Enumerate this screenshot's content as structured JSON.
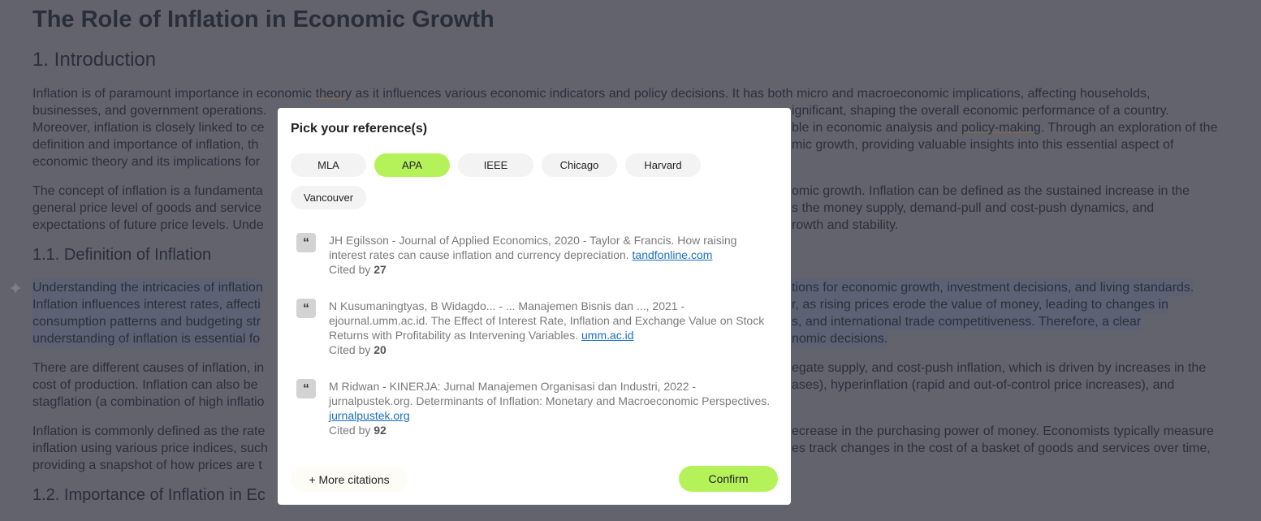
{
  "document": {
    "title": "The Role of Inflation in Economic Growth",
    "h_intro": "1. Introduction",
    "h_definition": "1.1. Definition of Inflation",
    "h_importance": "1.2. Importance of Inflation in Ec",
    "p1": [
      {
        "l": "Inflation is of paramount importance in economic ",
        "u": "theory",
        "l2": " as it influences various economic indicators and policy decisions. It has both micro and macroeconomic implications, affecting households,"
      },
      {
        "l": "businesses, and government operations.",
        "r": "ignificant, shaping the overall economic performance of a country."
      },
      {
        "l": "Moreover, inflation is closely linked to ce",
        "r": "ble in economic analysis and ",
        "ru": "policy-making",
        "r2": ". Through an exploration of the"
      },
      {
        "l": "definition and importance of inflation, th",
        "r": "mic growth, providing valuable insights into this essential aspect of"
      },
      {
        "l": "economic theory and its implications for",
        "r": ""
      }
    ],
    "p2": [
      {
        "l": "The concept of inflation is a fundamenta",
        "r": "omic growth. Inflation can be defined as the sustained increase in the"
      },
      {
        "l": "general price level of goods and service",
        "r": "s the money supply, demand-pull and cost-push dynamics, and"
      },
      {
        "l": "expectations of future price levels. Unde",
        "r": "rowth and stability."
      }
    ],
    "p3": [
      {
        "l": "Understanding the intricacies of inflation",
        "r": "tions for economic growth, investment decisions, and living standards."
      },
      {
        "l": "Inflation influences interest rates, affecti",
        "r": "r, as rising prices erode the value of money, leading to changes in"
      },
      {
        "l": "consumption patterns and budgeting str",
        "r": "s, and international trade competitiveness. Therefore, a clear"
      },
      {
        "l": "understanding of inflation is essential fo",
        "r": "nomic decisions."
      }
    ],
    "p4": [
      {
        "l": "There are different causes of inflation, in",
        "r": "egate supply, and cost-push inflation, which is driven by increases in the"
      },
      {
        "l": "cost of production. Inflation can also be",
        "r": "ases), hyperinflation (rapid and out-of-control price increases), and"
      },
      {
        "l": "stagflation (a combination of high inflatio",
        "r": ""
      }
    ],
    "p5": [
      {
        "l": "Inflation is commonly defined as the rate",
        "r": "ecrease in the purchasing power of money. Economists typically measure"
      },
      {
        "l": "inflation using various price indices, such",
        "r": "es track changes in the cost of a basket of goods and services over time,"
      },
      {
        "l": "providing a snapshot of how prices are t",
        "r": ""
      }
    ]
  },
  "modal": {
    "title": "Pick your reference(s)",
    "styles": [
      "MLA",
      "APA",
      "IEEE",
      "Chicago",
      "Harvard",
      "Vancouver"
    ],
    "selected_style": "APA",
    "accent": "#b5f25a",
    "citations": [
      {
        "text": "JH Egilsson - Journal of Applied Economics, 2020 - Taylor & Francis. How raising interest rates can cause inflation and currency depreciation. ",
        "link": "tandfonline.com",
        "cited_label": "Cited by ",
        "cited": "27"
      },
      {
        "text": "N Kusumaningtyas, B Widagdo... - ... Manajemen Bisnis dan ..., 2021 - ejournal.umm.ac.id. The Effect of Interest Rate, Inflation and Exchange Value on Stock Returns with Profitability as Intervening Variables. ",
        "link": "umm.ac.id",
        "cited_label": "Cited by ",
        "cited": "20"
      },
      {
        "text": "M Ridwan - KINERJA: Jurnal Manajemen Organisasi dan Industri, 2022 - jurnalpustek.org. Determinants of Inflation: Monetary and Macroeconomic Perspectives. ",
        "link": "jurnalpustek.org",
        "cited_label": "Cited by ",
        "cited": "92"
      }
    ],
    "quote_icon": "“",
    "more_label": "+ More citations",
    "confirm_label": "Confirm"
  },
  "icons": {
    "sparkle": "✦"
  }
}
